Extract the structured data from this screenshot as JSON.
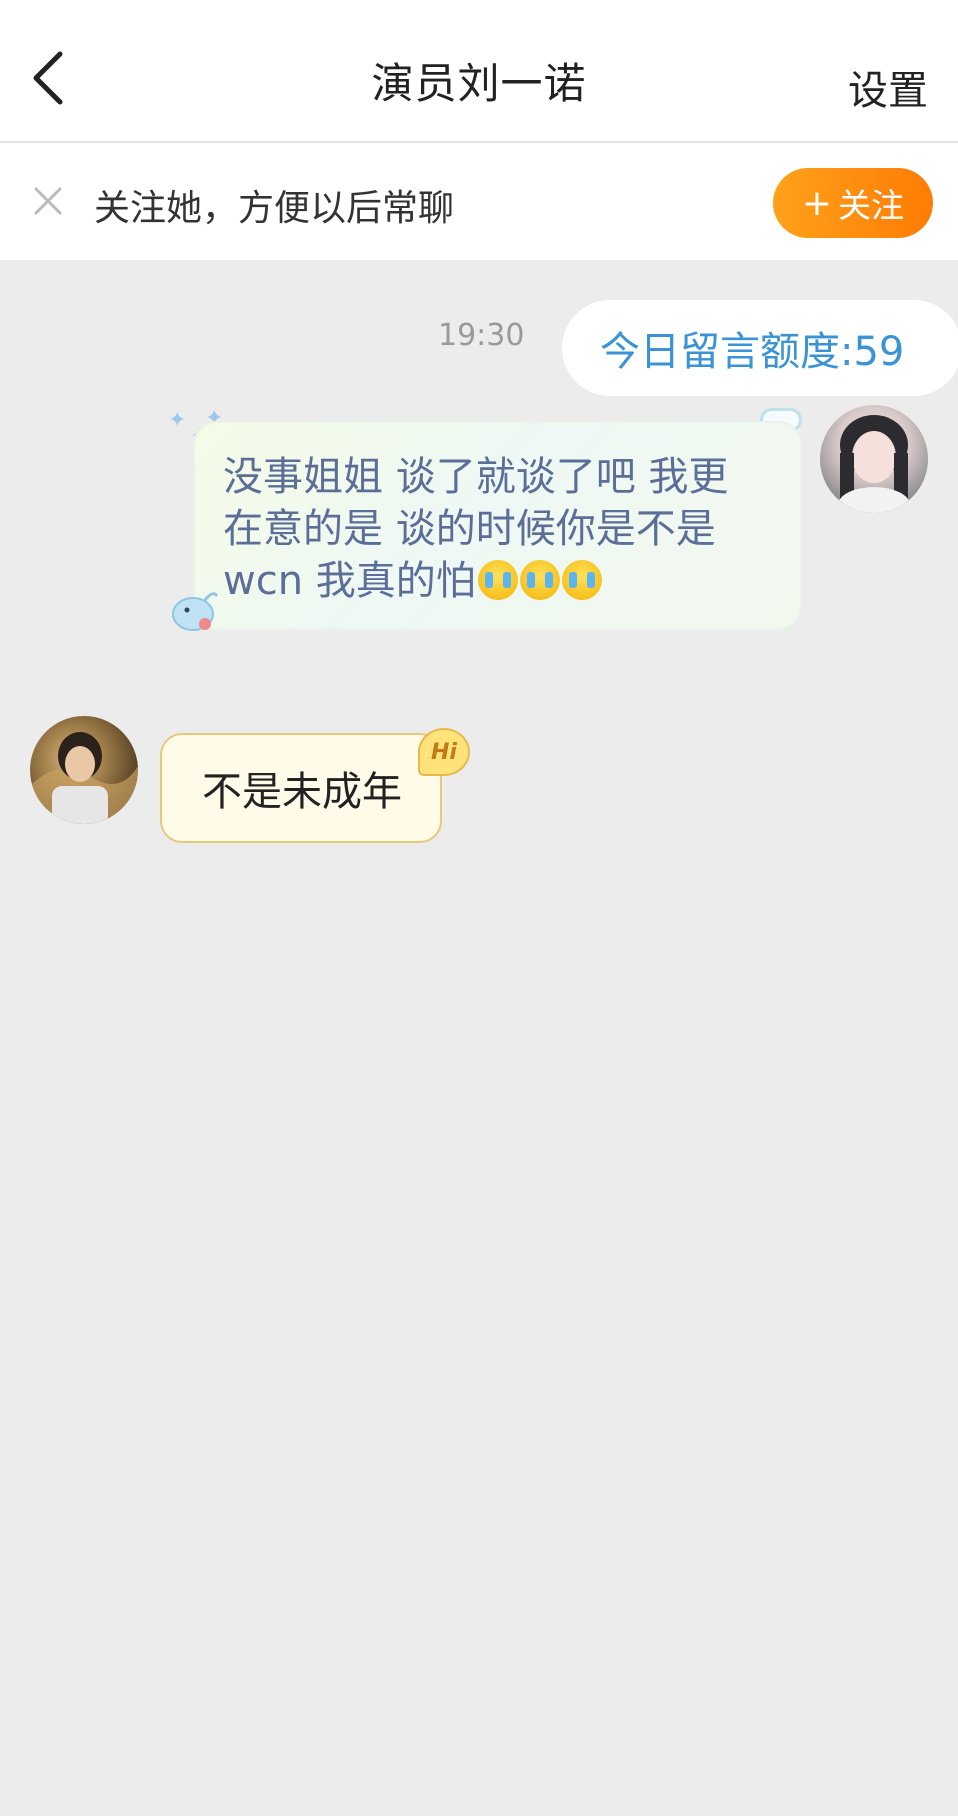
{
  "header": {
    "back_icon": "chevron-left-icon",
    "title": "演员刘一诺",
    "settings_label": "设置"
  },
  "follow_bar": {
    "close_icon": "close-icon",
    "text": "关注她，方便以后常聊",
    "button_plus": "+",
    "button_label": "关注"
  },
  "chat": {
    "timestamp": "19:30",
    "quota_message": "今日留言额度:59",
    "sent_message": {
      "line1": "没事姐姐 谈了就谈了吧 我更",
      "line2": "在意的是 谈的时候你是不是",
      "line3": "wcn 我真的怕",
      "emoji": "crying-face-icon",
      "emoji_count": 3
    },
    "received_message": {
      "text": "不是未成年",
      "badge": "Hi"
    }
  },
  "colors": {
    "follow_button": "#ff8c0e",
    "quota_text": "#3a93d4",
    "sent_text": "#5b6e98",
    "background": "#ececec"
  }
}
